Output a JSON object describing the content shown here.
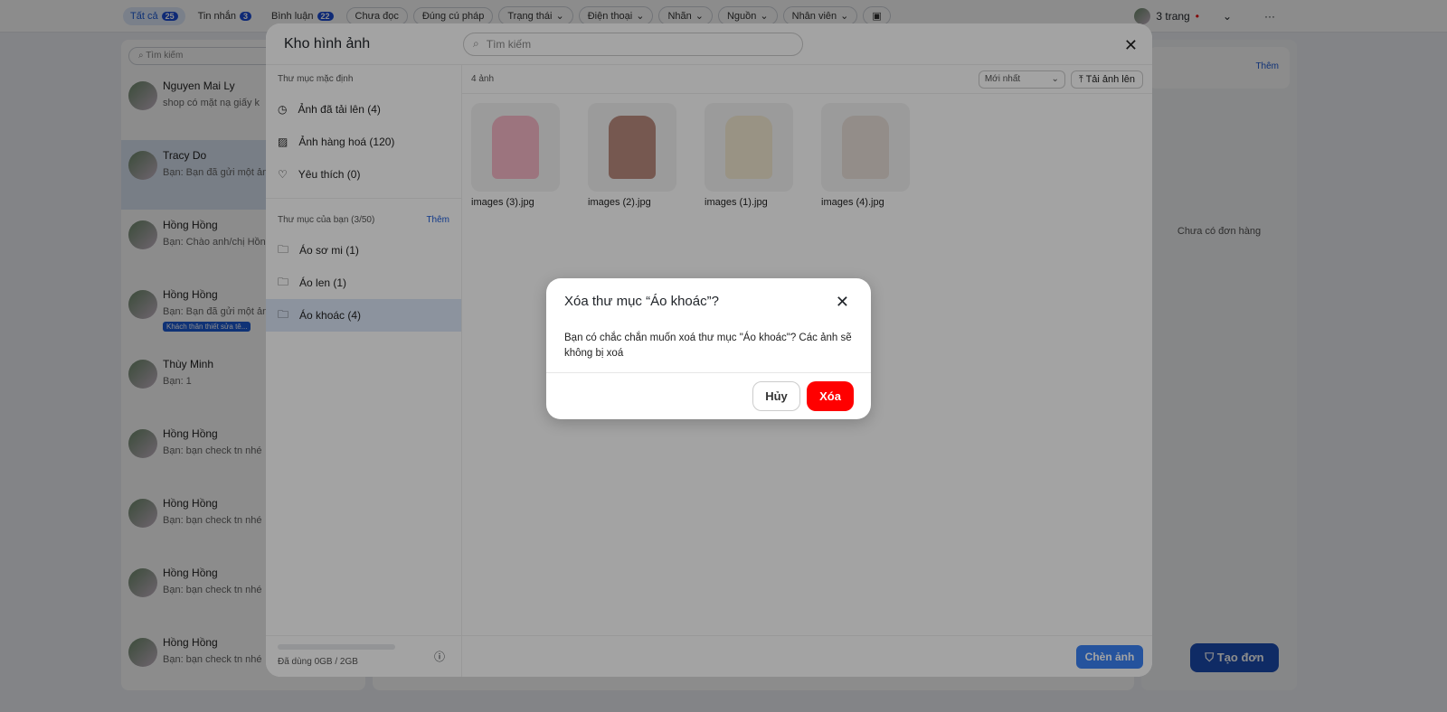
{
  "topbar": {
    "tabs": [
      {
        "label": "Tất cả",
        "count": "25"
      },
      {
        "label": "Tin nhắn",
        "count": "3"
      },
      {
        "label": "Bình luận",
        "count": "22"
      }
    ],
    "filters": [
      "Chưa đọc",
      "Đúng cú pháp",
      "Trạng thái",
      "Điện thoại",
      "Nhãn",
      "Nguồn",
      "Nhân viên"
    ],
    "pages": "3 trang"
  },
  "convlist": {
    "search_placeholder": "Tìm kiếm",
    "items": [
      {
        "name": "Nguyen Mai Ly",
        "msg": "shop có mặt nạ giấy k"
      },
      {
        "name": "Tracy Do",
        "msg": "Bạn: Bạn đã gửi một ảnh"
      },
      {
        "name": "Hồng Hồng",
        "msg": "Bạn: Chào anh/chị Hồng"
      },
      {
        "name": "Hồng Hồng",
        "msg": "Bạn: Bạn đã gửi một ảnh",
        "tag": "Khách thân thiết sửa tê..."
      },
      {
        "name": "Thùy Minh",
        "msg": "Bạn: 1"
      },
      {
        "name": "Hồng Hồng",
        "msg": "Bạn: bạn check tn nhé"
      },
      {
        "name": "Hồng Hồng",
        "msg": "Bạn: bạn check tn nhé"
      },
      {
        "name": "Hồng Hồng",
        "msg": "Bạn: bạn check tn nhé"
      },
      {
        "name": "Hồng Hồng",
        "msg": "Bạn: bạn check tn nhé"
      }
    ]
  },
  "right": {
    "more": "Thêm",
    "empty": "Chưa có đơn hàng",
    "create": "Tạo đơn"
  },
  "modal": {
    "title": "Kho hình ảnh",
    "search_placeholder": "Tìm kiếm",
    "default_section": "Thư mục mặc định",
    "default_items": [
      "Ảnh đã tải lên (4)",
      "Ảnh hàng hoá (120)",
      "Yêu thích (0)"
    ],
    "your_section": "Thư mục của bạn (3/50)",
    "add": "Thêm",
    "folders": [
      "Áo sơ mi (1)",
      "Áo len (1)",
      "Áo khoác (4)"
    ],
    "storage": "Đã dùng 0GB / 2GB",
    "storage_used": 0,
    "count": "4 ảnh",
    "sort": "Mới nhất",
    "upload": "Tải ảnh lên",
    "images": [
      "images (3).jpg",
      "images (2).jpg",
      "images (1).jpg",
      "images (4).jpg"
    ],
    "insert": "Chèn ảnh"
  },
  "dialog": {
    "title": "Xóa thư mục “Áo khoác”?",
    "body": "Bạn có chắc chắn muốn xoá thư mục \"Áo khoác\"? Các ảnh sẽ không bị xoá",
    "cancel": "Hủy",
    "delete": "Xóa",
    "delete_color": "#ff0000"
  }
}
